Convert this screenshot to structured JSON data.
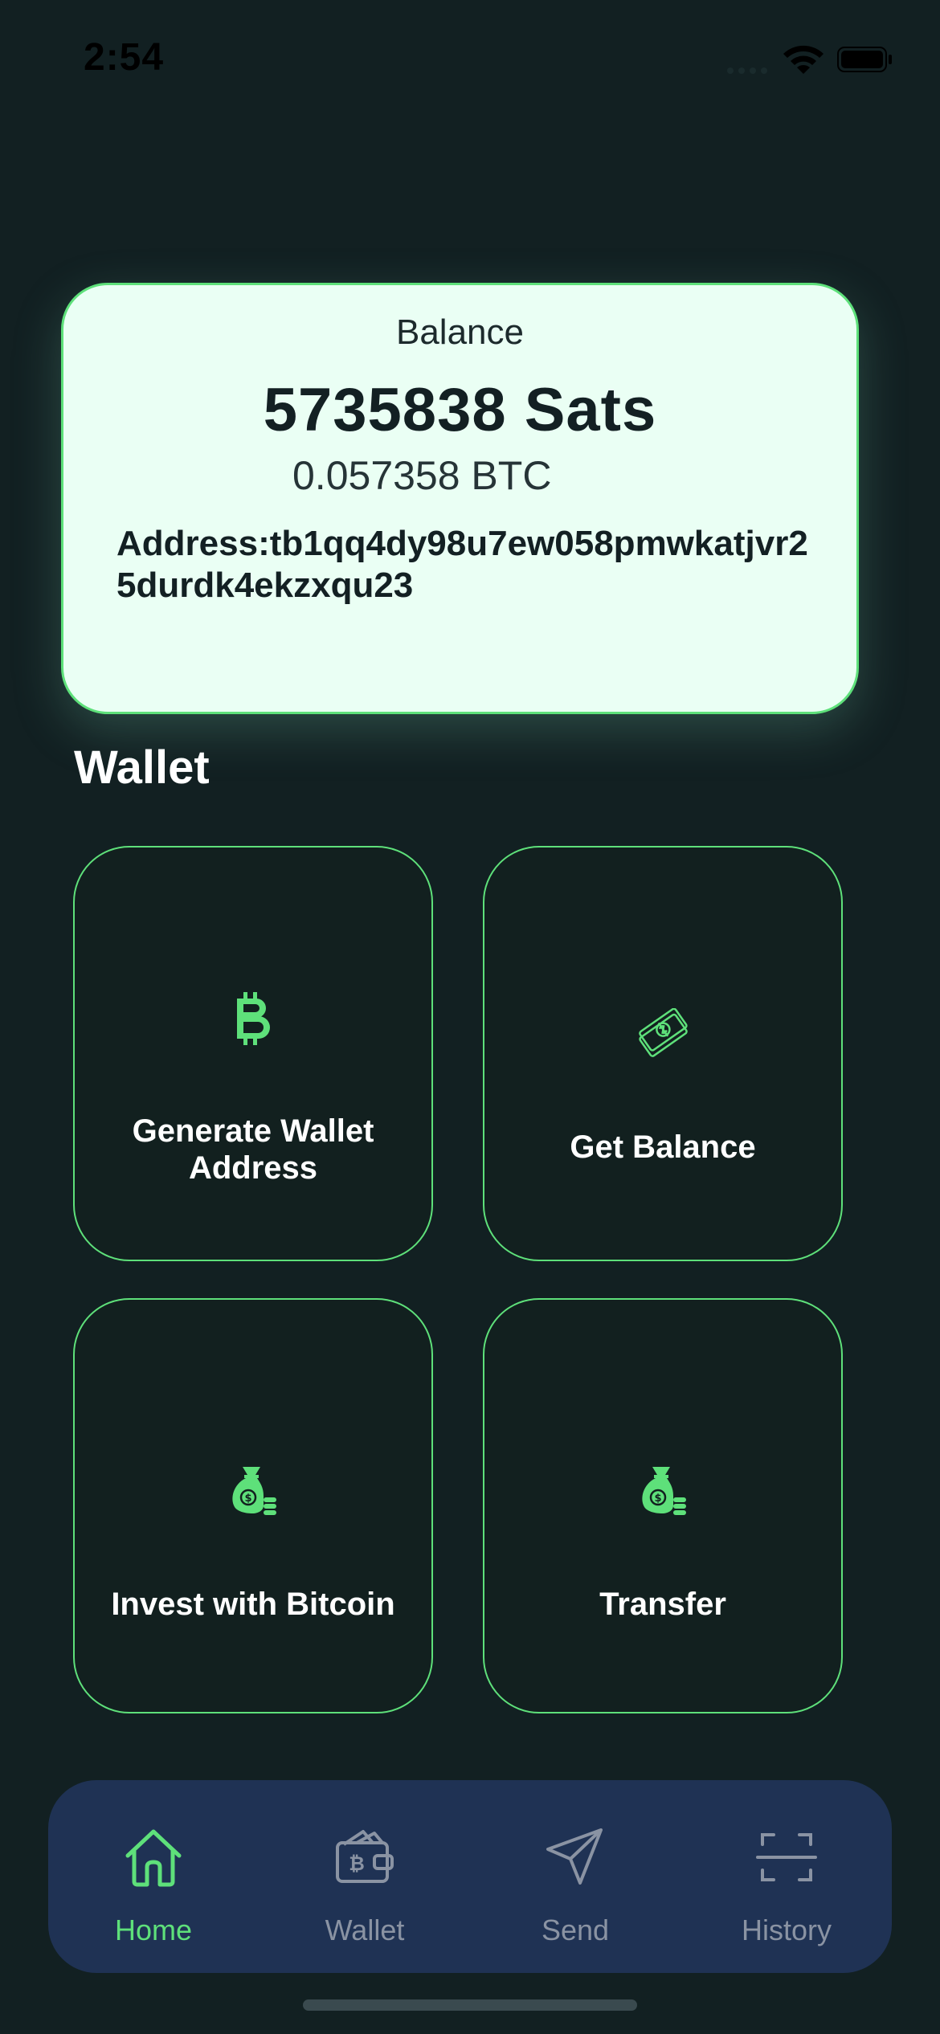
{
  "status_bar": {
    "time": "2:54"
  },
  "balance_card": {
    "label": "Balance",
    "sats": "5735838 Sats",
    "btc": "0.057358 BTC",
    "address": "Address:tb1qq4dy98u7ew058pmwkatjvr25durdk4ekzxqu23"
  },
  "section": {
    "title": "Wallet"
  },
  "tiles": [
    {
      "label": "Generate Wallet Address",
      "icon": "bitcoin-icon"
    },
    {
      "label": "Get Balance",
      "icon": "money-bills-icon"
    },
    {
      "label": "Invest with Bitcoin",
      "icon": "money-bag-icon"
    },
    {
      "label": "Transfer",
      "icon": "money-bag-icon"
    }
  ],
  "nav": {
    "items": [
      {
        "label": "Home",
        "icon": "home-icon",
        "active": true
      },
      {
        "label": "Wallet",
        "icon": "wallet-icon",
        "active": false
      },
      {
        "label": "Send",
        "icon": "send-icon",
        "active": false
      },
      {
        "label": "History",
        "icon": "scan-icon",
        "active": false
      }
    ]
  },
  "colors": {
    "background": "#122022",
    "accent": "#5ee07a",
    "card": "#eafff4",
    "nav_bar": "#1f3254",
    "nav_inactive": "#8a93a3"
  }
}
